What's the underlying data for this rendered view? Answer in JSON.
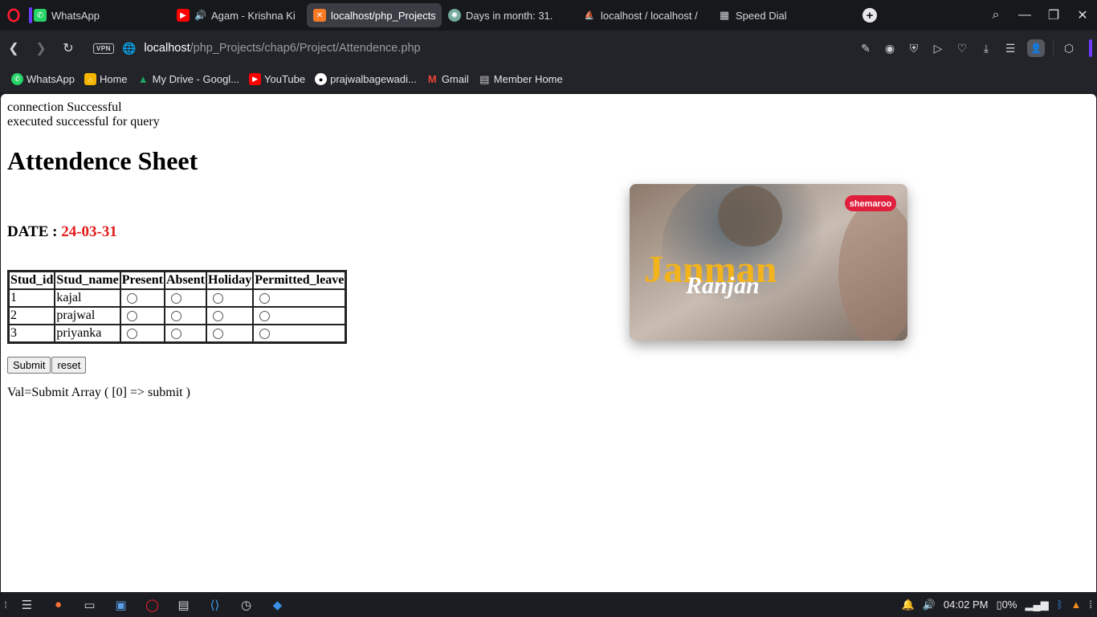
{
  "tabs": [
    {
      "title": "WhatsApp",
      "icon": "whatsapp-icon",
      "color": "#25d366",
      "active": false
    },
    {
      "title": "Agam - Krishna Ki",
      "icon": "youtube-icon",
      "color": "#ff0000",
      "active": false
    },
    {
      "title": "localhost/php_Projects",
      "icon": "xampp-icon",
      "color": "#fb7a24",
      "active": true
    },
    {
      "title": "Days in month: 31.",
      "icon": "chatgpt-icon",
      "color": "#74aa9c",
      "active": false
    },
    {
      "title": "localhost / localhost /",
      "icon": "phpmyadmin-icon",
      "color": "#f29111",
      "active": false
    },
    {
      "title": "Speed Dial",
      "icon": "speed-dial-icon",
      "color": "#aaaaaa",
      "active": false
    }
  ],
  "address": {
    "vpn_label": "VPN",
    "host": "localhost",
    "path": "/php_Projects/chap6/Project/Attendence.php"
  },
  "bookmarks": [
    {
      "label": "WhatsApp",
      "icon": "whatsapp-icon",
      "color": "#25d366"
    },
    {
      "label": "Home",
      "icon": "home-icon",
      "color": "#f4b400"
    },
    {
      "label": "My Drive - Googl...",
      "icon": "google-drive-icon",
      "color": "#1fa463"
    },
    {
      "label": "YouTube",
      "icon": "youtube-icon",
      "color": "#ff0000"
    },
    {
      "label": "prajwalbagewadi...",
      "icon": "github-icon",
      "color": "#ffffff"
    },
    {
      "label": "Gmail",
      "icon": "gmail-icon",
      "color": "#ea4335"
    },
    {
      "label": "Member Home",
      "icon": "page-icon",
      "color": "#cccccc"
    }
  ],
  "page": {
    "msg_connection": "connection Successful",
    "msg_query": "executed successful for query",
    "heading": "Attendence Sheet",
    "date_label": "DATE :",
    "date_value": "24-03-31",
    "table": {
      "headers": [
        "Stud_id",
        "Stud_name",
        "Present",
        "Absent",
        "Holiday",
        "Permitted_leave"
      ],
      "rows": [
        {
          "id": "1",
          "name": "kajal"
        },
        {
          "id": "2",
          "name": "prajwal"
        },
        {
          "id": "3",
          "name": "priyanka"
        }
      ]
    },
    "submit_label": "Submit",
    "reset_label": "reset",
    "val_text": "Val=Submit Array ( [0] => submit )"
  },
  "video": {
    "title_line1": "Janman",
    "title_line2": "Ranjan",
    "brand": "shemaroo"
  },
  "taskbar": {
    "time": "04:02 PM",
    "battery": "0%"
  },
  "colors": {
    "accent": "#6b3cff",
    "date_red": "#e21b1b"
  }
}
